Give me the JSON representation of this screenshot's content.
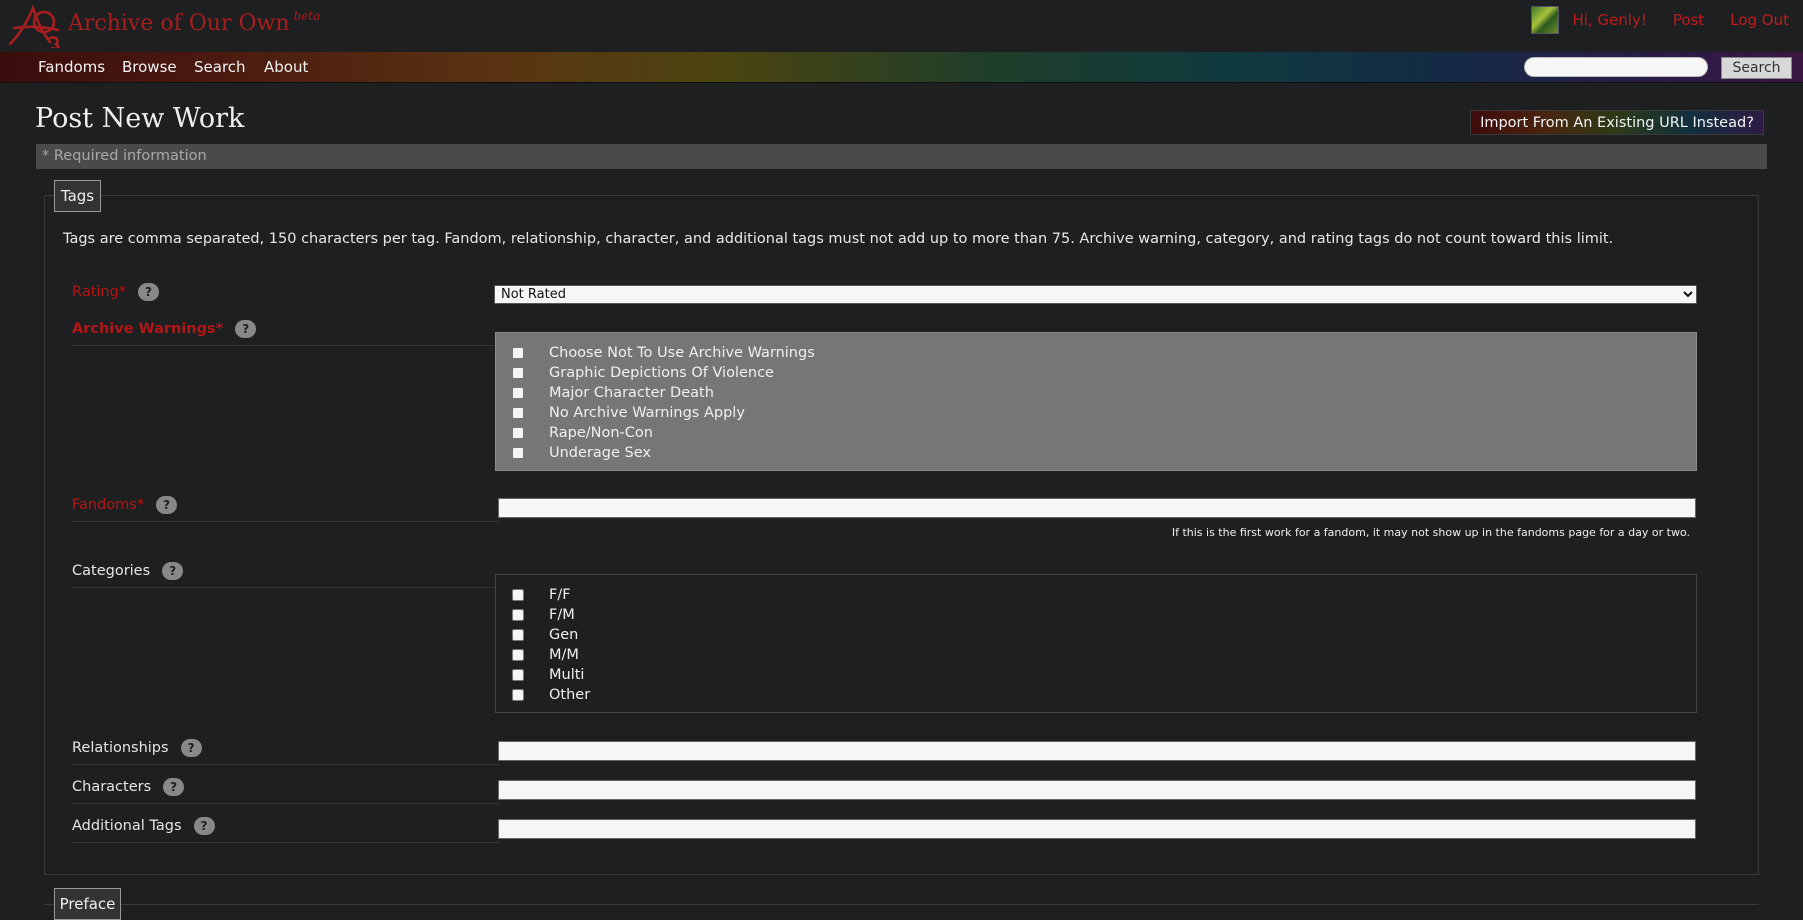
{
  "header": {
    "site_title": "Archive of Our Own",
    "site_badge": "beta",
    "logo_icon": "ao3-logo-icon",
    "user_greeting": "Hi, Genly!",
    "post_link": "Post",
    "logout_link": "Log Out"
  },
  "nav": {
    "items": [
      "Fandoms",
      "Browse",
      "Search",
      "About"
    ],
    "search_placeholder": "",
    "search_button": "Search"
  },
  "page": {
    "title": "Post New Work",
    "import_button": "Import From An Existing URL Instead?",
    "required_info": "* Required information"
  },
  "tags": {
    "legend": "Tags",
    "note": "Tags are comma separated, 150 characters per tag. Fandom, relationship, character, and additional tags must not add up to more than 75. Archive warning, category, and rating tags do not count toward this limit.",
    "help_glyph": "?",
    "rating": {
      "label": "Rating*",
      "selected": "Not Rated"
    },
    "warnings": {
      "label": "Archive Warnings*",
      "options": [
        "Choose Not To Use Archive Warnings",
        "Graphic Depictions Of Violence",
        "Major Character Death",
        "No Archive Warnings Apply",
        "Rape/Non-Con",
        "Underage Sex"
      ]
    },
    "fandoms": {
      "label": "Fandoms*",
      "value": "",
      "note": "If this is the first work for a fandom, it may not show up in the fandoms page for a day or two."
    },
    "categories": {
      "label": "Categories",
      "options": [
        "F/F",
        "F/M",
        "Gen",
        "M/M",
        "Multi",
        "Other"
      ]
    },
    "relationships": {
      "label": "Relationships",
      "value": ""
    },
    "characters": {
      "label": "Characters",
      "value": ""
    },
    "additional_tags": {
      "label": "Additional Tags",
      "value": ""
    }
  },
  "preface": {
    "legend": "Preface"
  },
  "colors": {
    "background": "#1d1f21",
    "required_red": "#b31616",
    "link_red": "#c01c1c",
    "panel_gray": "#767676"
  }
}
